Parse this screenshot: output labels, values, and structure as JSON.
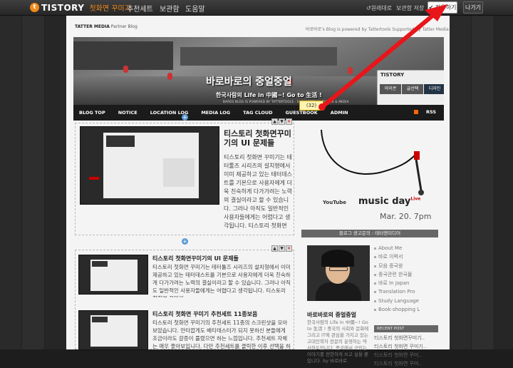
{
  "topbar": {
    "logo_text": "TISTORY",
    "logo_sub": "첫화면 꾸미기",
    "nav": [
      "추천세트",
      "보관함",
      "도움말"
    ],
    "reset": "원래대로",
    "save_to_storage": "보관함 저장",
    "apply": "적용하기",
    "exit": "나가기"
  },
  "header": {
    "partner_brand": "TATTER MEDIA",
    "partner_label": "Partner Blog",
    "powered": "바로바로's Blog is powered by Tattertools Supported by Tatter Media",
    "blog_title": "바로바로의 중얼중얼",
    "blog_desc": "한국사람의 Life in 中國~! Go to 生活 !",
    "blog_tiny": "BAROS BLOG IS POWERED BY TATTERTOOLS · SUPPORTED BY TATTER & MEDIA"
  },
  "tistory_panel": {
    "title": "TISTORY",
    "tabs": [
      "아이콘",
      "글선택",
      "디자인"
    ]
  },
  "menu": {
    "items": [
      "BLOG TOP",
      "NOTICE",
      "LOCATION LOG",
      "MEDIA LOG",
      "TAG CLOUD",
      "GUESTBOOK",
      "ADMIN"
    ],
    "rss": "RSS"
  },
  "tooltip": "(32)",
  "posts": [
    {
      "title": "티스토리 첫화면꾸미기의 UI 문제들",
      "body": "티스토리 첫화면 꾸미기는 테터툴즈 시리즈의 설치형에서 이미 제공하고 있는 테터데스트를 기본으로 사용자에게 더 욱 친숙하게 다가가려는 노력의 결실이라고 할 수 있습니다. 그러나 아직도 일반적인 사용자들에게는 어렵다고 생각됩니다. 티스토리 첫화면 꾸미기가 .."
    },
    {
      "title": "티스토리 첫화면꾸미기의 UI 문제들",
      "body": "티스토리 첫화면 꾸미기는 테터툴즈 시리즈의 설치형에서 이미 제공하고 있는 테터데스트를 기본으로 사용자에게 더욱 친숙하게 다가가려는 노력의 결실이라고 할 수 있습니다. 그러나 아직도 일반적인 사용자들에게는 어렵다고 생각됩니다. 티스토리 첫화면 꾸미기 .."
    },
    {
      "title": "티스토리 첫화면 꾸미기 추천세트 11종보음",
      "body": "티스토리 첫화면 꾸미기의 추천세트 11종의 스크린샷을 모아보았습니다. 안타깝게도 베티테스터가 되지 못하신 분들에게 조금이라도 갈증이 풀렸으면 하는 느낌입니다. 추천세트 자체는 매우 좋아보입니다. 다만 추천세트를 클릭한 이후 선택을 하는 화면이 .."
    }
  ],
  "sidebar": {
    "youtube": "YouTube",
    "music_day": "music day",
    "live": "Live",
    "date": "Mar. 20. 7pm",
    "notice_bar": "블로그 광고문의 : 테터앤미디어",
    "profile_name": "바로바로의 중얼중얼",
    "profile_desc": "한국사람의 Life in 中國~! Go to 生活 ! 중국의 사회와 문화에 그리고 IT에 관심을 가지고 있는 고대인학자 전문의 운영하는 약사하도입니다. 중국에서 구입는 이야기를 전한하게 쓰고 싶을 뿐입니다. by 바로바로",
    "categories": [
      "About Me",
      "바로 이력서",
      "모음 중국왕",
      "중국관련 한국몰",
      "바로 In Japan",
      "Translation Pro",
      "Study Language",
      "Book-shopping L"
    ],
    "recent_header": "RECENT POST",
    "recent": [
      "티스토리 첫화면꾸미기..",
      "티스토리 첫화면 꾸미기..",
      "티스토리 첫화면 꾸미..",
      "티스토리 첫화면 꾸미.."
    ]
  },
  "colors": {
    "tistory_orange": "#f08a1a",
    "arrow_red": "#e8151a",
    "menu_bg": "#1b1b1b"
  }
}
